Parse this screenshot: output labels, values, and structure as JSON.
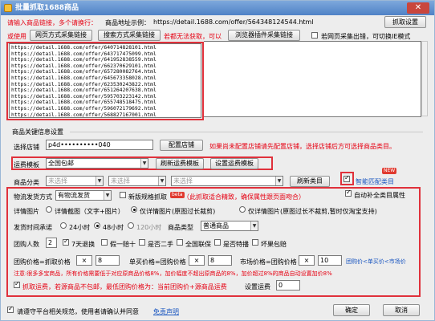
{
  "window": {
    "title": "批量抓取1688商品",
    "close": "✕"
  },
  "top": {
    "hint1": "请输入商品链接，多个请换行：",
    "example_label": "商品地址示例：",
    "example_url": "https://detail.1688.com/offer/564348124544.html",
    "fetch_button": "抓取设置",
    "or_use": "或使用",
    "web_collect_button": "网页方式采集链接",
    "search_collect_button": "搜索方式采集链接",
    "cannot_fetch": "若都无法获取，可以",
    "plugin_collect_button": "浏览器插件采集链接",
    "slow_fetch_checkbox": "若网页采集出错，可切换IE模式"
  },
  "url_list": [
    "https://detail.1688.com/offer/640714828101.html",
    "https://detail.1688.com/offer/643717475099.html",
    "https://detail.1688.com/offer/641952838559.html",
    "https://detail.1688.com/offer/662370629101.html",
    "https://detail.1688.com/offer/657280082764.html",
    "https://detail.1688.com/offer/645673358028.html",
    "https://detail.1688.com/offer/623530243822.html",
    "https://detail.1688.com/offer/651264207638.html",
    "https://detail.1688.com/offer/595703223142.html",
    "https://detail.1688.com/offer/655748518475.html",
    "https://detail.1688.com/offer/596072179692.html",
    "https://detail.1688.com/offer/568827167001.html"
  ],
  "settings": {
    "section_title": "商品关键信息设置",
    "select_shop_label": "选择店铺",
    "shop_value": "p4d••••••••••040",
    "config_shop_button": "配置店铺",
    "shop_hint": "如果尚未配置店铺请先配置店铺，选择店铺后方可选择商品类目。",
    "shipping_template_label": "运费模板",
    "shipping_template_value": "全国包邮",
    "refresh_template_button": "刷新运费模板",
    "set_template_button": "设置运费模板",
    "category_label": "商品分类",
    "category_placeholder1": "未选择",
    "category_placeholder2": "未选择",
    "category_placeholder3": "未选择",
    "refresh_category_button": "刷新类目",
    "smart_match_label": "智能匹配类目",
    "new_badge": "NEW"
  },
  "options": {
    "ship_method_label": "物流发货方式",
    "ship_method_value": "有物流发货",
    "new_shipping_label": "新版规格抓取",
    "beta_badge": "beta",
    "new_shipping_hint": "（此抓取适合精致，确保属性跟页面吻合）",
    "auto_fill_label": "自动补全类目属性",
    "detail_images_label": "详情图片",
    "detail_opt1": "详情截图（文字+图片）",
    "detail_opt2": "仅详情图片(原图过长裁剪)",
    "detail_opt3": "仅详情图片(原图过长不裁剪,暂时仅淘宝支持)",
    "ship_time_label": "发货时间承诺",
    "ship_opt1": "24小时",
    "ship_opt2": "48小时",
    "ship_opt3": "120小时",
    "goods_type_label": "商品类型",
    "goods_type_value": "普通商品",
    "group_count_label": "团购人数",
    "group_count_value": "2",
    "returns_label": "7天退换",
    "fake_pay_label": "假一赔十",
    "second_hand_label": "是否二手",
    "national_label": "全国联保",
    "presale_label": "是否特播",
    "broken_label": "坏果包赔",
    "group_price_label": "团购价格=抓取价格",
    "group_price_value": "8",
    "single_price_label": "单买价格=团购价格",
    "single_price_value": "8",
    "market_price_label": "市场价格=团购价格",
    "market_price_value": "10",
    "price_rule_hint": "团购价<单买价<市场价",
    "warning": "注意:很多多宝商品，所有价格需要低于对应原商品价格8%，加价幅度不超出原商品的8%，加价超过8%的商品自动设置加价8%",
    "include_shipping_label": "抓取运费，若源商品不包邮，最低团购价格为：当前团购价+源商品运费",
    "set_shipping_label": "设置运费",
    "set_shipping_value": "0",
    "ops": [
      "+",
      "×",
      "+",
      "×",
      "+",
      "×"
    ]
  },
  "footer": {
    "agree_label": "请遵守平台相关规范，使用者请确认并同意",
    "disclaimer_link": "免责声明",
    "ok_button": "确定",
    "cancel_button": "取消"
  },
  "colors": {
    "red_frame": "#e0313b",
    "hint_red": "#e60012",
    "link_blue": "#1a56c0"
  }
}
